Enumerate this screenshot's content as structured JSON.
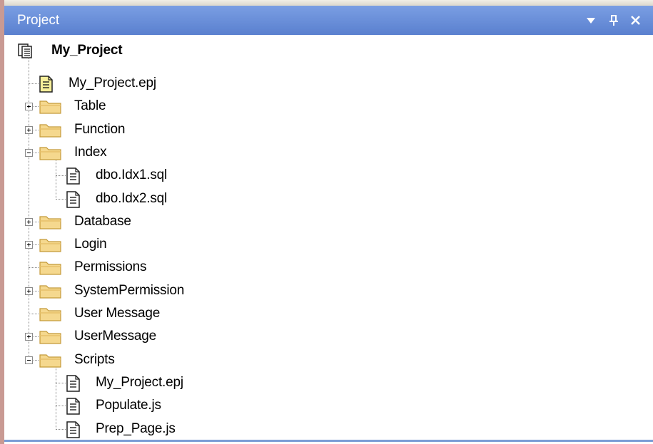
{
  "panel": {
    "title": "Project",
    "buttons": [
      {
        "name": "dropdown",
        "icon": "chevron-down-icon",
        "glyph": "▼"
      },
      {
        "name": "pin",
        "icon": "pin-icon",
        "glyph": "ᛩ"
      },
      {
        "name": "close",
        "icon": "close-icon",
        "glyph": "✕"
      }
    ]
  },
  "tree": {
    "root": {
      "label": "My_Project",
      "icon": "project-icon"
    },
    "items": [
      {
        "label": "My_Project.epj",
        "type": "file",
        "icon": "project-file-icon",
        "depth": 1,
        "expander": null
      },
      {
        "label": "Table",
        "type": "folder",
        "icon": "folder-icon",
        "depth": 1,
        "expander": "+"
      },
      {
        "label": "Function",
        "type": "folder",
        "icon": "folder-icon",
        "depth": 1,
        "expander": "+"
      },
      {
        "label": "Index",
        "type": "folder",
        "icon": "folder-icon",
        "depth": 1,
        "expander": "-"
      },
      {
        "label": "dbo.Idx1.sql",
        "type": "file",
        "icon": "document-icon",
        "depth": 2,
        "expander": null
      },
      {
        "label": "dbo.Idx2.sql",
        "type": "file",
        "icon": "document-icon",
        "depth": 2,
        "expander": null
      },
      {
        "label": "Database",
        "type": "folder",
        "icon": "folder-icon",
        "depth": 1,
        "expander": "+"
      },
      {
        "label": "Login",
        "type": "folder",
        "icon": "folder-icon",
        "depth": 1,
        "expander": "+"
      },
      {
        "label": "Permissions",
        "type": "folder",
        "icon": "folder-icon",
        "depth": 1,
        "expander": null
      },
      {
        "label": "SystemPermission",
        "type": "folder",
        "icon": "folder-icon",
        "depth": 1,
        "expander": "+"
      },
      {
        "label": "User Message",
        "type": "folder",
        "icon": "folder-icon",
        "depth": 1,
        "expander": null
      },
      {
        "label": "UserMessage",
        "type": "folder",
        "icon": "folder-icon",
        "depth": 1,
        "expander": "+"
      },
      {
        "label": "Scripts",
        "type": "folder",
        "icon": "folder-icon",
        "depth": 1,
        "expander": "-"
      },
      {
        "label": "My_Project.epj",
        "type": "file",
        "icon": "document-icon",
        "depth": 2,
        "expander": null
      },
      {
        "label": "Populate.js",
        "type": "file",
        "icon": "document-icon",
        "depth": 2,
        "expander": null
      },
      {
        "label": "Prep_Page.js",
        "type": "file",
        "icon": "document-icon",
        "depth": 2,
        "expander": null
      }
    ]
  },
  "colors": {
    "titlebar": "#6a8fda",
    "folder_fill": "#f5d88e",
    "folder_stroke": "#c49a3a",
    "project_file_fill": "#f7ef9a",
    "tree_line": "#8a8a8a"
  }
}
